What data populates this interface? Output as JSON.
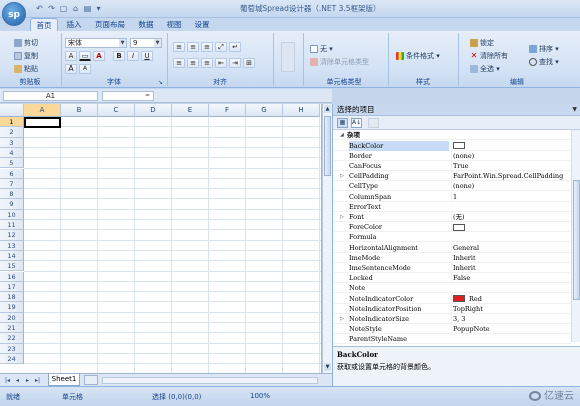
{
  "app": {
    "logo_text": "sp",
    "title": "葡萄城Spread设计器（.NET 3.5框架版）"
  },
  "quick_access": [
    "↶",
    "↷",
    "▢",
    "⌂",
    "▤",
    "▾"
  ],
  "tabs": [
    "首页",
    "插入",
    "页面布局",
    "数据",
    "视图",
    "设置"
  ],
  "ribbon": {
    "clipboard": {
      "cut": "剪切",
      "copy": "复制",
      "paste": "粘贴",
      "label": "剪贴板"
    },
    "font": {
      "name": "宋体",
      "size": "9",
      "label": "字体",
      "bold": "B",
      "italic": "I",
      "underline": "U",
      "grow": "A",
      "shrink": "A"
    },
    "alignment": {
      "label": "对齐"
    },
    "cell_type": {
      "none": "无",
      "clear": "清除单元格类型",
      "label": "单元格类型"
    },
    "style": {
      "conditional": "条件格式",
      "label": "样式"
    },
    "editing": {
      "lock": "锁定",
      "clear_all": "清除所有",
      "select_all": "全选",
      "sort": "排序",
      "find": "查找",
      "label": "编辑"
    }
  },
  "formula_bar": {
    "name_box": "A1",
    "fx": "="
  },
  "grid": {
    "columns": [
      "A",
      "B",
      "C",
      "D",
      "E",
      "F",
      "G",
      "H"
    ],
    "rows": [
      "1",
      "2",
      "3",
      "4",
      "5",
      "6",
      "7",
      "8",
      "9",
      "10",
      "11",
      "12",
      "13",
      "14",
      "15",
      "16",
      "17",
      "18",
      "19",
      "20",
      "21",
      "22",
      "23",
      "24"
    ],
    "sheet_tab": "Sheet1",
    "nav": [
      "|◂",
      "◂",
      "▸",
      "▸|"
    ]
  },
  "property_panel": {
    "header": "选择的项目",
    "category": "杂项",
    "properties": [
      {
        "name": "BackColor",
        "value": "",
        "swatch": "#ffffff"
      },
      {
        "name": "Border",
        "value": "(none)"
      },
      {
        "name": "CanFocus",
        "value": "True"
      },
      {
        "name": "CellPadding",
        "value": "FarPoint.Win.Spread.CellPadding",
        "expand": "▷"
      },
      {
        "name": "CellType",
        "value": "(none)"
      },
      {
        "name": "ColumnSpan",
        "value": "1"
      },
      {
        "name": "ErrorText",
        "value": ""
      },
      {
        "name": "Font",
        "value": "(无)",
        "expand": "▷"
      },
      {
        "name": "ForeColor",
        "value": "",
        "swatch": "#ffffff"
      },
      {
        "name": "Formula",
        "value": ""
      },
      {
        "name": "HorizontalAlignment",
        "value": "General"
      },
      {
        "name": "ImeMode",
        "value": "Inherit"
      },
      {
        "name": "ImeSentenceMode",
        "value": "Inherit"
      },
      {
        "name": "Locked",
        "value": "False"
      },
      {
        "name": "Note",
        "value": ""
      },
      {
        "name": "NoteIndicatorColor",
        "value": "Red",
        "swatch": "#e02020"
      },
      {
        "name": "NoteIndicatorPosition",
        "value": "TopRight"
      },
      {
        "name": "NoteIndicatorSize",
        "value": "3, 3",
        "expand": "▷"
      },
      {
        "name": "NoteStyle",
        "value": "PopupNote"
      },
      {
        "name": "ParentStyleName",
        "value": ""
      }
    ],
    "description_title": "BackColor",
    "description_text": "获取或设置单元格的背景颜色。"
  },
  "status": {
    "ready": "就绪",
    "cell": "单元格",
    "selection": "选择 (0,0)(0,0)",
    "zoom": "100%"
  },
  "watermark": "亿速云"
}
